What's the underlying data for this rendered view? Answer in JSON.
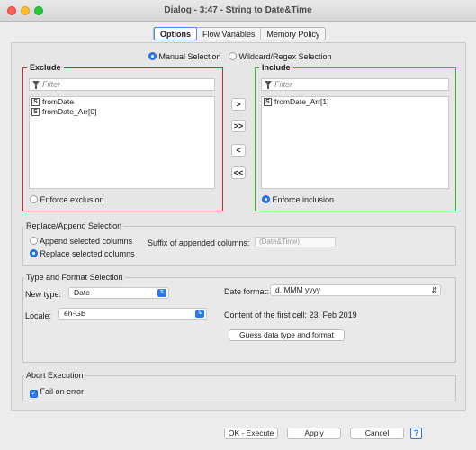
{
  "window": {
    "title": "Dialog - 3:47 - String to Date&Time"
  },
  "tabs": [
    {
      "label": "Options",
      "active": true
    },
    {
      "label": "Flow Variables",
      "active": false
    },
    {
      "label": "Memory Policy",
      "active": false
    }
  ],
  "selection_mode": {
    "manual_label": "Manual Selection",
    "wildcard_label": "Wildcard/Regex Selection",
    "selected": "manual"
  },
  "exclude": {
    "title": "Exclude",
    "filter_placeholder": "Filter",
    "items": [
      {
        "type": "S",
        "name": "fromDate"
      },
      {
        "type": "S",
        "name": "fromDate_Arr[0]"
      }
    ],
    "enforce_label": "Enforce exclusion",
    "color": "#d42a2a"
  },
  "include": {
    "title": "Include",
    "filter_placeholder": "Filter",
    "items": [
      {
        "type": "S",
        "name": "fromDate_Arr[1]"
      }
    ],
    "enforce_label": "Enforce inclusion",
    "color": "#2cc22c"
  },
  "move_buttons": [
    ">",
    ">>",
    "<",
    "<<"
  ],
  "replace_append": {
    "title": "Replace/Append Selection",
    "append_label": "Append selected columns",
    "replace_label": "Replace selected columns",
    "selected": "replace",
    "suffix_label": "Suffix of appended columns:",
    "suffix_placeholder": "(Date&Time)"
  },
  "type_format": {
    "title": "Type and Format Selection",
    "new_type_label": "New type:",
    "new_type_value": "Date",
    "date_format_label": "Date format:",
    "date_format_value": "d. MMM yyyy",
    "locale_label": "Locale:",
    "locale_value": "en-GB",
    "content_label": "Content of the first cell: 23. Feb 2019",
    "guess_button": "Guess data type and format"
  },
  "abort": {
    "title": "Abort Execution",
    "fail_label": "Fail on error",
    "fail_checked": true
  },
  "footer": {
    "ok_execute": "OK - Execute",
    "apply": "Apply",
    "cancel": "Cancel",
    "help": "?"
  },
  "colors": {
    "accent": "#2a77f0",
    "exclude_border": "#d42a2a",
    "include_border": "#2cc22c"
  }
}
